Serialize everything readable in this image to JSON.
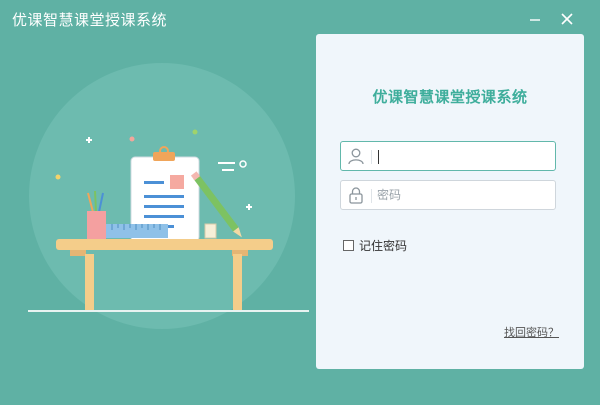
{
  "window": {
    "title": "优课智慧课堂授课系统",
    "minimize_glyph": "—",
    "close_glyph": "✕"
  },
  "login": {
    "heading": "优课智慧课堂授课系统",
    "username": {
      "value": "",
      "placeholder": "",
      "icon": "user-icon"
    },
    "password": {
      "value": "",
      "placeholder": "密码",
      "icon": "lock-icon"
    },
    "remember_label": "记住密码",
    "remember_checked": false,
    "forgot_label": "找回密码？"
  },
  "colors": {
    "background": "#5fb1a4",
    "panel": "#f0f6fb",
    "accent": "#3fae9c"
  }
}
